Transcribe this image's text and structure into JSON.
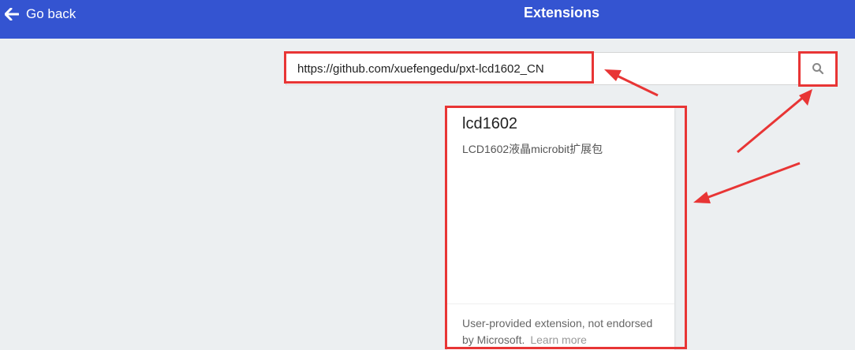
{
  "colors": {
    "header_bg": "#3454d1",
    "highlight": "#e83535",
    "page_bg": "#eceff1"
  },
  "header": {
    "back_label": "Go back",
    "back_icon": "arrow-left-icon",
    "title": "Extensions"
  },
  "search": {
    "value": "https://github.com/xuefengedu/pxt-lcd1602_CN",
    "button_icon": "search-icon"
  },
  "results": [
    {
      "name": "lcd1602",
      "description": "LCD1602液晶microbit扩展包",
      "disclaimer": "User-provided extension, not endorsed by Microsoft.",
      "learn_more": "Learn more"
    }
  ]
}
